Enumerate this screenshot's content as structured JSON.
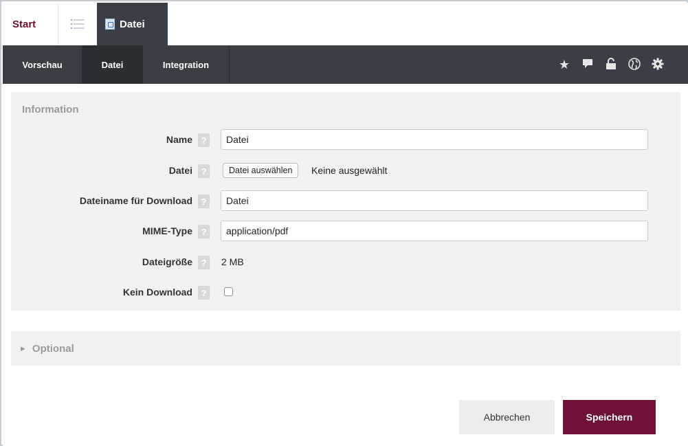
{
  "top_tabs": {
    "start": "Start",
    "list_icon": "list-icon",
    "active_tab": {
      "icon": "pdf-file-icon",
      "label": "Datei"
    }
  },
  "nav": {
    "tabs": [
      "Vorschau",
      "Datei",
      "Integration"
    ],
    "active_index": 1,
    "icons": [
      "star-icon",
      "comment-icon",
      "unlock-icon",
      "globe-icon",
      "gear-icon"
    ]
  },
  "information": {
    "title": "Information",
    "help_glyph": "?",
    "fields": {
      "name": {
        "label": "Name",
        "value": "Datei"
      },
      "file": {
        "label": "Datei",
        "button": "Datei auswählen",
        "status": "Keine ausgewählt"
      },
      "download_name": {
        "label": "Dateiname für Download",
        "value": "Datei"
      },
      "mime": {
        "label": "MIME-Type",
        "value": "application/pdf"
      },
      "size": {
        "label": "Dateigröße",
        "value": "2 MB"
      },
      "no_download": {
        "label": "Kein Download",
        "checked": false
      }
    }
  },
  "optional": {
    "label": "Optional",
    "expanded": false
  },
  "actions": {
    "cancel": "Abbrechen",
    "save": "Speichern"
  },
  "colors": {
    "brand": "#6f1139",
    "navbar": "#3a3f45",
    "panel": "#f1f1f1"
  }
}
